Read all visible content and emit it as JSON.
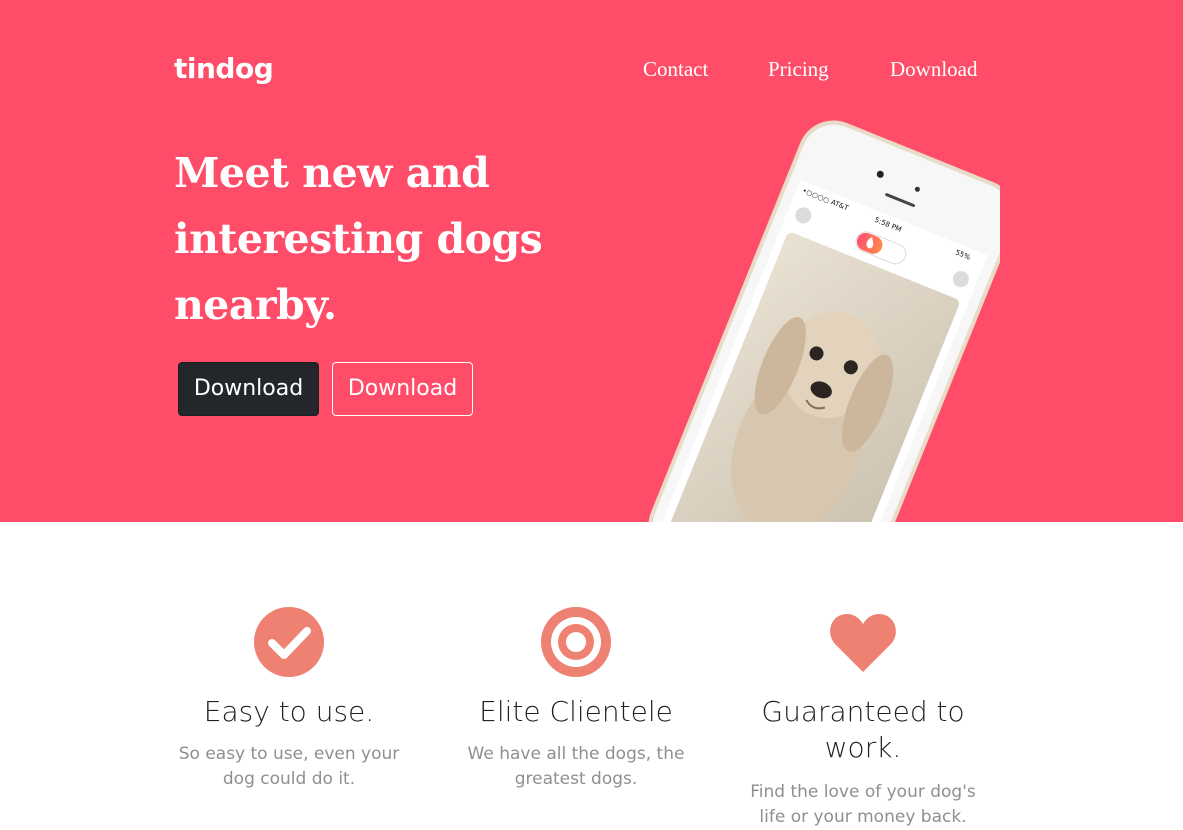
{
  "brand": {
    "name": "tindog"
  },
  "nav": {
    "contact": "Contact",
    "pricing": "Pricing",
    "download": "Download"
  },
  "hero": {
    "headline_line1": "Meet new and",
    "headline_line2": "interesting dogs",
    "headline_line3": "nearby.",
    "btn_primary": "Download",
    "btn_outline": "Download"
  },
  "phone": {
    "carrier": "•○○○○ AT&T",
    "time": "5:58 PM",
    "battery": "55%"
  },
  "features": [
    {
      "icon": "check-circle-icon",
      "title": "Easy to use.",
      "text": "So easy to use, even your dog could do it."
    },
    {
      "icon": "bullseye-icon",
      "title": "Elite Clientele",
      "text": "We have all the dogs, the greatest dogs."
    },
    {
      "icon": "heart-icon",
      "title": "Guaranteed to work.",
      "text": "Find the love of your dog's life or your money back."
    }
  ],
  "colors": {
    "hero_bg": "#ff4c68",
    "icon": "#ef8172",
    "dark_button": "#23272b"
  }
}
